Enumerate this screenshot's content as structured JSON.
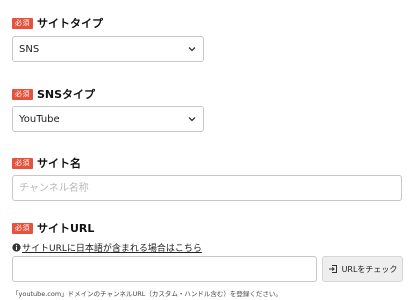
{
  "badge_label": "必須",
  "site_type": {
    "label": "サイトタイプ",
    "selected": "SNS"
  },
  "sns_type": {
    "label": "SNSタイプ",
    "selected": "YouTube"
  },
  "site_name": {
    "label": "サイト名",
    "placeholder": "チャンネル名称"
  },
  "site_url": {
    "label": "サイトURL",
    "help_link": "サイトURLに日本語が含まれる場合はこちら",
    "value": "",
    "check_button": "URLをチェック",
    "note": "「youtube.com」ドメインのチャンネルURL（カスタム・ハンドル含む）を登録ください。"
  }
}
